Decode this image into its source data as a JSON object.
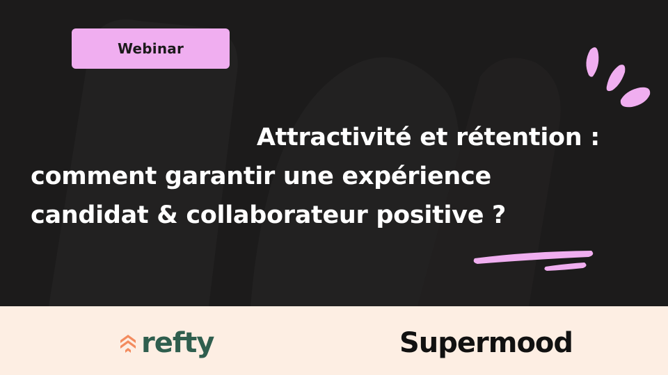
{
  "badge": {
    "label": "Webinar"
  },
  "title": {
    "line1": "Attractivité et rétention :",
    "line2": "comment garantir une expérience",
    "line3": "candidat & collaborateur positive ?"
  },
  "logos": {
    "refty": "refty",
    "supermood": "Supermood"
  },
  "colors": {
    "background": "#1c1b1b",
    "accent_pink": "#f0aef0",
    "footer": "#fdeee3",
    "refty_green": "#2f5e4e",
    "refty_orange": "#f38b5e",
    "text": "#ffffff"
  }
}
